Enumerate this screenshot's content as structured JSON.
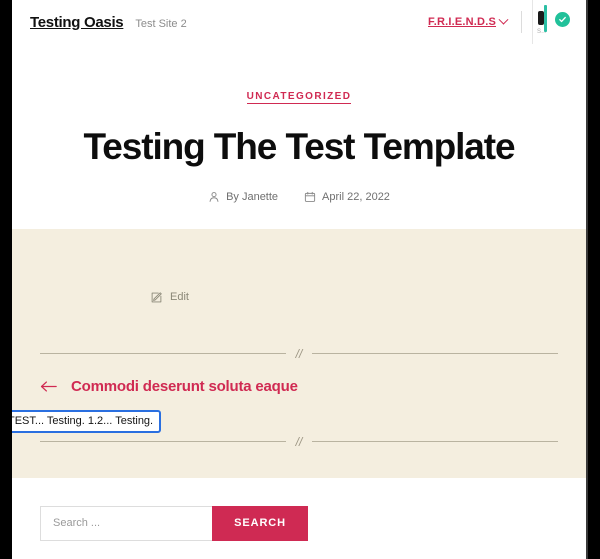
{
  "header": {
    "site_title": "Testing Oasis",
    "tagline": "Test Site 2",
    "nav": {
      "menu_label": "F.R.I.E.N.D.S",
      "chevron_icon": "chevron-down-icon"
    },
    "corner_widget": {
      "label": "S...",
      "check_icon": "check-circle-icon",
      "accent_color": "#21c19a"
    }
  },
  "post": {
    "category": "UNCATEGORIZED",
    "title": "Testing The Test Template",
    "author_prefix": "By",
    "author": "By Janette",
    "author_icon": "user-icon",
    "date": "April 22, 2022",
    "date_icon": "calendar-icon",
    "edit_label": "Edit",
    "edit_icon": "edit-pencil-icon",
    "divider_mark": "//"
  },
  "post_nav": {
    "previous_label": "Commodi deserunt soluta eaque",
    "arrow_icon": "arrow-left-icon"
  },
  "focus_overlay": {
    "text": "TEST... Testing. 1.2... Testing.",
    "border_color": "#2a6fe0"
  },
  "search": {
    "placeholder": "Search ...",
    "value": "",
    "button_label": "SEARCH",
    "button_color": "#cf2a53"
  },
  "theme": {
    "accent": "#d02a52",
    "body_background": "#f4eedf",
    "page_background": "#ffffff",
    "text": "#0d0d0d"
  }
}
